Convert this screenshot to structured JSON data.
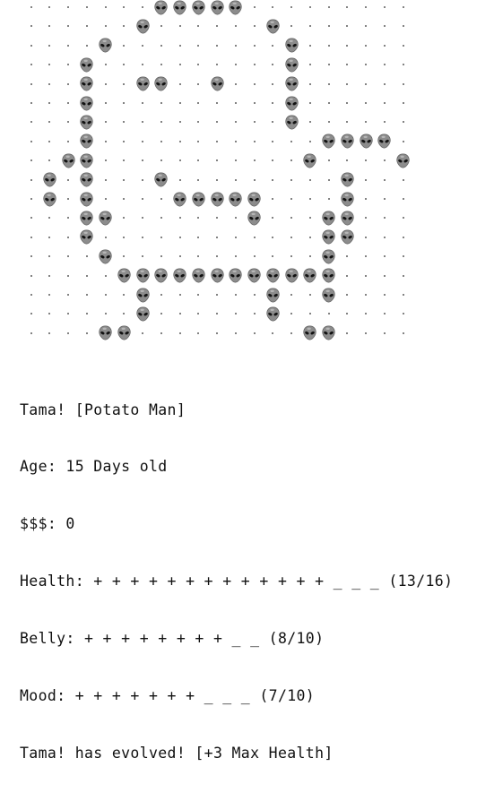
{
  "sprite": {
    "empty_icon": "dot",
    "filled_icon": "alien-head-icon",
    "alien_color": "#8c8c8c",
    "dot_color": "#5a5a5a",
    "rows": [
      "000000011111000000000",
      "000000100000010000000",
      "000010000000001000000",
      "000100000000001000000",
      "000100100010001000000",
      "000100000000001000000",
      "000100000000001000000",
      "000100000000000011110",
      "001100000000000100001",
      "010100000000000001000",
      "010100000000000001000",
      "000100000000000001000",
      "000100000000000001000",
      "000010000000000010000",
      "000001111111111100000",
      "000000100000010000000",
      "000000100000010000000",
      "000011000000000110000"
    ],
    "extra_cells": [
      [
        4,
        7
      ],
      [
        9,
        7
      ],
      [
        10,
        8
      ],
      [
        10,
        9
      ],
      [
        10,
        10
      ],
      [
        10,
        11
      ],
      [
        10,
        12
      ],
      [
        11,
        4
      ],
      [
        11,
        12
      ],
      [
        11,
        16
      ],
      [
        12,
        3
      ],
      [
        12,
        16
      ],
      [
        13,
        16
      ],
      [
        14,
        16
      ],
      [
        15,
        16
      ]
    ]
  },
  "status": {
    "name_line": "Tama! [Potato Man]",
    "age_line": "Age: 15 Days old",
    "money_line": "$$$: 0",
    "health_line": "Health: + + + + + + + + + + + + + _ _ _ (13/16)",
    "belly_line": "Belly: + + + + + + + + _ _ (8/10)",
    "mood_line": "Mood: + + + + + + + _ _ _ (7/10)",
    "event_line": "Tama! has evolved! [+3 Max Health]"
  },
  "stats": {
    "health": {
      "current": 13,
      "max": 16
    },
    "belly": {
      "current": 8,
      "max": 10
    },
    "mood": {
      "current": 7,
      "max": 10
    }
  }
}
